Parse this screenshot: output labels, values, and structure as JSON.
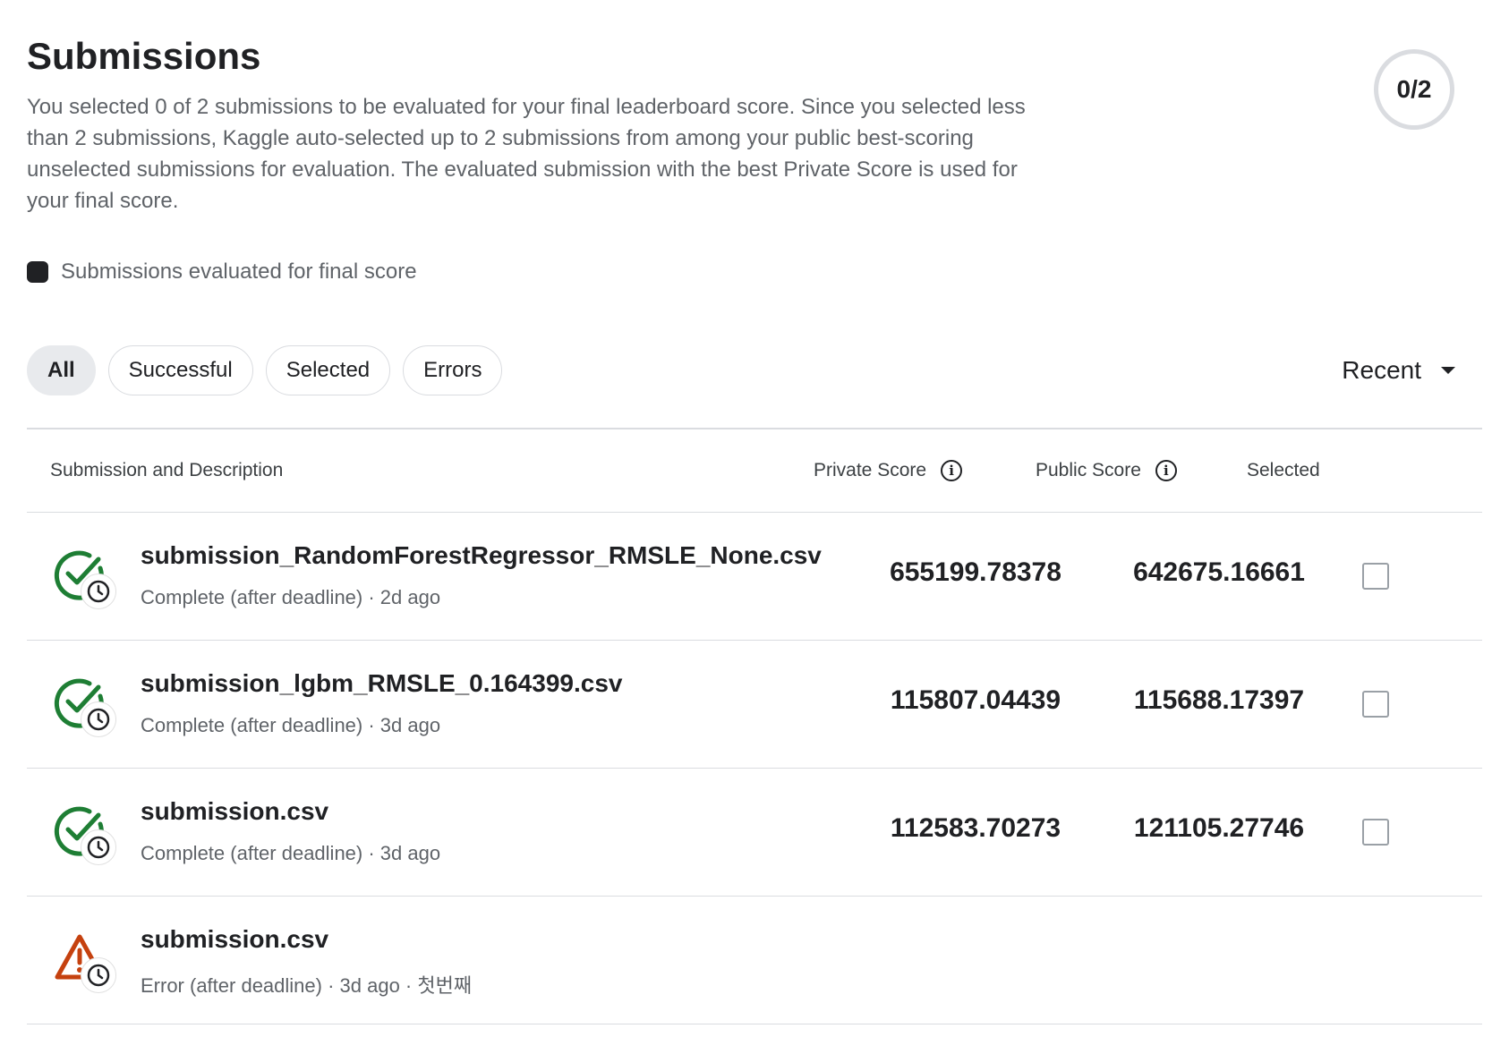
{
  "header": {
    "title": "Submissions",
    "description": "You selected 0 of 2 submissions to be evaluated for your final leaderboard score. Since you selected less than 2 submissions, Kaggle auto-selected up to 2 submissions from among your public best-scoring unselected submissions for evaluation. The evaluated submission with the best Private Score is used for your final score.",
    "counter": "0/2"
  },
  "legend": {
    "label": "Submissions evaluated for final score"
  },
  "filters": {
    "chips": [
      "All",
      "Successful",
      "Selected",
      "Errors"
    ],
    "active": "All"
  },
  "sort": {
    "label": "Recent"
  },
  "table": {
    "headers": {
      "submission": "Submission and Description",
      "private_score": "Private Score",
      "public_score": "Public Score",
      "selected": "Selected"
    },
    "rows": [
      {
        "name": "submission_RandomForestRegressor_RMSLE_None.csv",
        "status_text": "Complete (after deadline) · 2d ago",
        "status": "complete",
        "private_score": "655199.78378",
        "public_score": "642675.16661",
        "selected": false
      },
      {
        "name": "submission_lgbm_RMSLE_0.164399.csv",
        "status_text": "Complete (after deadline) · 3d ago",
        "status": "complete",
        "private_score": "115807.04439",
        "public_score": "115688.17397",
        "selected": false
      },
      {
        "name": "submission.csv",
        "status_text": "Complete (after deadline) · 3d ago",
        "status": "complete",
        "private_score": "112583.70273",
        "public_score": "121105.27746",
        "selected": false
      },
      {
        "name": "submission.csv",
        "status_text": "Error (after deadline) · 3d ago · 첫번째",
        "status": "error",
        "private_score": "",
        "public_score": "",
        "selected": null
      }
    ]
  },
  "colors": {
    "success": "#1e7e34",
    "error": "#c5410f",
    "text": "#202124",
    "muted": "#5f6368",
    "border": "#dadce0"
  },
  "icons": {
    "success": "check-circle-icon",
    "error": "warning-triangle-icon",
    "clock": "clock-icon",
    "info": "info-icon",
    "sort": "caret-down-icon"
  }
}
